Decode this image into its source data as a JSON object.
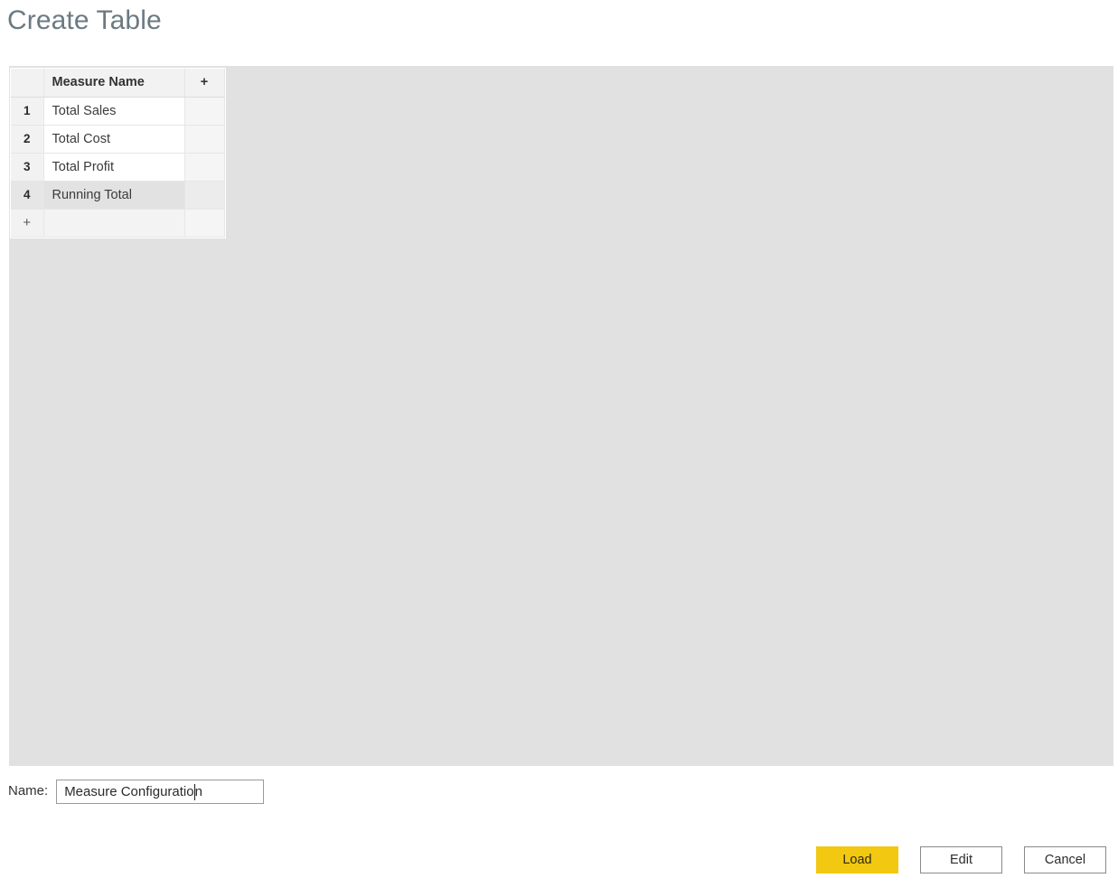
{
  "page": {
    "title": "Create Table"
  },
  "grid": {
    "headers": {
      "index": "",
      "measure_name": "Measure Name",
      "add_column": "+"
    },
    "rows": [
      {
        "index": "1",
        "measure_name": "Total Sales",
        "selected": false
      },
      {
        "index": "2",
        "measure_name": "Total Cost",
        "selected": false
      },
      {
        "index": "3",
        "measure_name": "Total Profit",
        "selected": false
      },
      {
        "index": "4",
        "measure_name": "Running Total",
        "selected": true
      }
    ],
    "add_row_label": "+"
  },
  "name_field": {
    "label": "Name:",
    "value": "Measure Configuration",
    "value_before_caret": "Measure Configuratio",
    "value_after_caret": "n"
  },
  "footer": {
    "load_label": "Load",
    "edit_label": "Edit",
    "cancel_label": "Cancel"
  },
  "colors": {
    "accent": "#F2C811",
    "panel_background": "#E1E1E1",
    "title_text": "#6B7A82",
    "grid_header_background": "#F2F2F2",
    "selected_row_background": "#E2E2E2"
  }
}
